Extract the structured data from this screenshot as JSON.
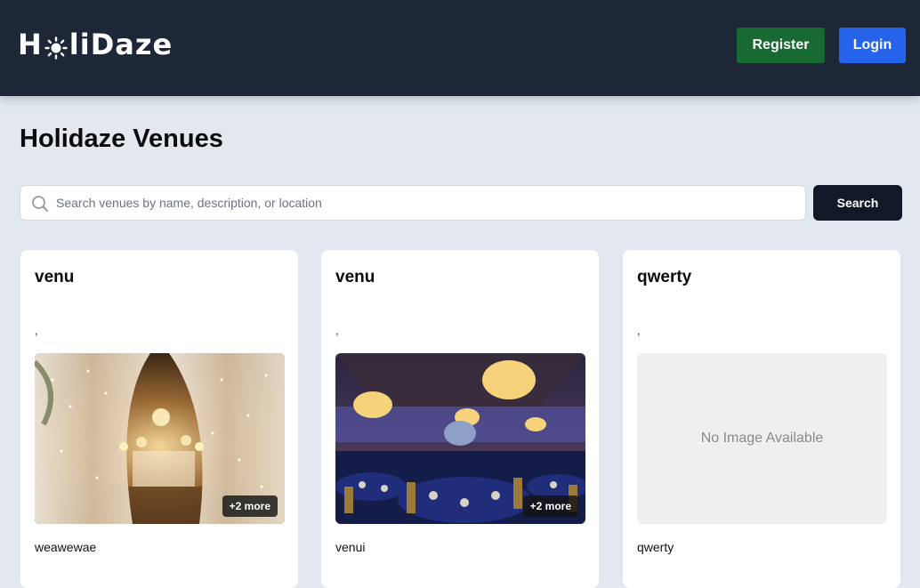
{
  "header": {
    "logo_text_left": "H",
    "logo_text_right": "liDaze",
    "register_label": "Register",
    "login_label": "Login"
  },
  "main": {
    "title": "Holidaze Venues",
    "search": {
      "placeholder": "Search venues by name, description, or location",
      "value": "",
      "button_label": "Search"
    }
  },
  "venues": [
    {
      "name": "venu",
      "location": ",",
      "description": "weawewae",
      "more_images": "+2 more",
      "has_image": true,
      "image_theme": "draped-hall"
    },
    {
      "name": "venu",
      "location": ",",
      "description": "venui",
      "more_images": "+2 more",
      "has_image": true,
      "image_theme": "blue-ballroom"
    },
    {
      "name": "qwerty",
      "location": ",",
      "description": "qwerty",
      "no_image_text": "No Image Available",
      "has_image": false
    }
  ],
  "colors": {
    "header_bg": "#1e2738",
    "register_bg": "#186a33",
    "login_bg": "#2563eb",
    "search_btn_bg": "#111827",
    "page_bg": "#e3e8f0"
  },
  "icons": [
    "sun-icon",
    "search-icon"
  ]
}
